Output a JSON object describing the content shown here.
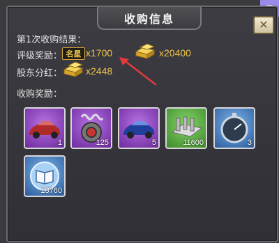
{
  "dialog": {
    "title": "收购信息",
    "close_icon": "close-icon",
    "heading": "第1次收购结果：",
    "rating_label": "评级奖励：",
    "star_badge": "名星",
    "rating_star_value": "x1700",
    "rating_gold_value": "x20400",
    "dividend_label": "股东分红：",
    "dividend_gold_value": "x2448",
    "rewards_label": "收购奖励："
  },
  "rewards": [
    {
      "icon": "sports-car-icon",
      "rarity": "purple",
      "qty": "1"
    },
    {
      "icon": "spring-gear-icon",
      "rarity": "purple",
      "qty": "125"
    },
    {
      "icon": "blue-car-icon",
      "rarity": "purple",
      "qty": "5"
    },
    {
      "icon": "metal-part-icon",
      "rarity": "green",
      "qty": "11600"
    },
    {
      "icon": "stopwatch-icon",
      "rarity": "blue",
      "qty": "3"
    },
    {
      "icon": "book-icon",
      "rarity": "blue",
      "qty": "13760"
    }
  ]
}
